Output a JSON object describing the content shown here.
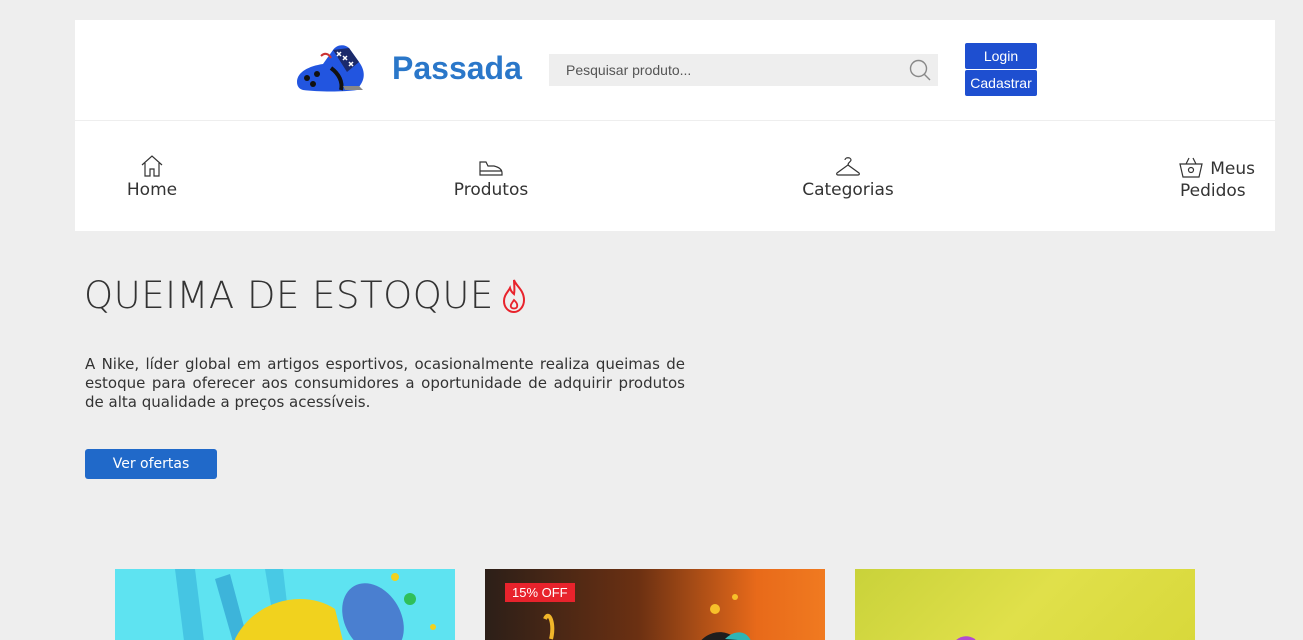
{
  "header": {
    "brand": "Passada",
    "logo_icon": "cleat-shoe-icon",
    "search_placeholder": "Pesquisar produto...",
    "login_label": "Login",
    "signup_label": "Cadastrar"
  },
  "nav": {
    "items": [
      {
        "label": "Home",
        "icon": "house-icon"
      },
      {
        "label": "Produtos",
        "icon": "shoe-icon"
      },
      {
        "label": "Categorias",
        "icon": "hanger-icon"
      },
      {
        "label_line1": "Meus",
        "label_line2": "Pedidos",
        "icon": "basket-icon"
      }
    ]
  },
  "hero": {
    "title": "QUEIMA DE ESTOQUE",
    "title_icon": "fire-icon",
    "description": "A Nike, líder global em artigos esportivos, ocasionalmente realiza queimas de estoque para oferecer aos consumidores a oportunidade de adquirir produtos de alta qualidade a preços acessíveis.",
    "cta": "Ver ofertas"
  },
  "products": [
    {
      "badge": ""
    },
    {
      "badge": "15% OFF"
    },
    {
      "badge": ""
    }
  ],
  "colors": {
    "brand": "#2a77c9",
    "auth_button": "#1e4fd0",
    "cta": "#2069c9",
    "fire": "#e8232c",
    "background": "#eeeeee"
  }
}
